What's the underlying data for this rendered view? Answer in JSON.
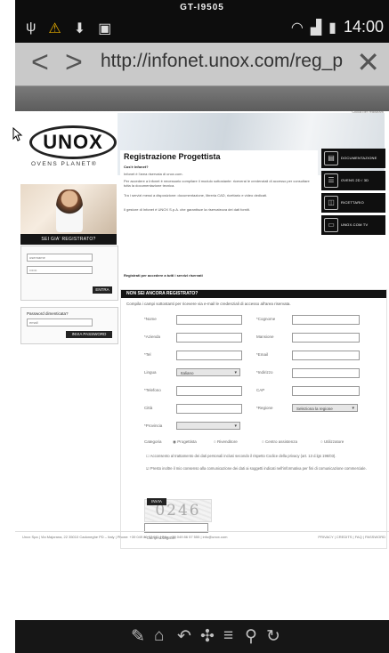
{
  "status": {
    "model": "GT-I9505",
    "time": "14:00",
    "icons_left": [
      "usb-icon",
      "alert-icon",
      "download-icon",
      "screenshot-icon"
    ],
    "icons_right": [
      "wifi-icon",
      "signal-icon",
      "battery-icon"
    ]
  },
  "browser": {
    "url": "http://infonet.unox.com/reg_p"
  },
  "site": {
    "logo_text": "UNOX",
    "logo_sub": "OVENS PLANET®",
    "register_bar": "SEI GIA' REGISTRATO?",
    "login": {
      "user_placeholder": "username",
      "pass_placeholder": "••••••",
      "button": "ENTRA"
    },
    "forgot": {
      "title": "Password dimenticata?",
      "placeholder": "email",
      "button": "INVIA PASSWORD"
    },
    "top_link": "Clicca per registrarti",
    "intro": {
      "title": "Registrazione Progettista",
      "subtitle": "Cos'è Infonet?",
      "p1": "Infonet è l'area riservata di unox.com.",
      "p2": "Per accedere a Infonet è necessario compilare il modulo sottostante: riceverai le credenziali di accesso per consultare tutta la documentazione tecnica.",
      "p3": "Tra i servizi messi a disposizione: documentazione, libreria CAD, ricettario e video dedicati.",
      "p4": "Il gestore di Infonet è UNOX S.p.A. che garantisce la riservatezza dei dati forniti.",
      "footer": "Registrati per accedere a tutti i servizi riservati"
    },
    "right_menu": [
      {
        "label": "DOCUMENTAZIONE",
        "icon": "document-icon"
      },
      {
        "label": "OVENS 2D / 3D",
        "icon": "database-icon"
      },
      {
        "label": "RICETTARIO",
        "icon": "recipe-icon"
      },
      {
        "label": "UNOX.COM TV",
        "icon": "tv-icon"
      }
    ],
    "form": {
      "header": "NON SEI ANCORA REGISTRATO?",
      "desc": "Compila i campi sottostanti per ricevere via e-mail le credenziali di accesso all'area riservata.",
      "fields": {
        "nome": "*Nome",
        "cognome": "*Cognome",
        "azienda": "*Azienda",
        "mansione": "Mansione",
        "tel": "*Tel",
        "email": "*Email",
        "lingua": "Lingua",
        "lingua_value": "Italiano",
        "indirizzo": "*Indirizzo",
        "telefono": "*Telefono",
        "cap": "CAP",
        "citta": "Città",
        "regione": "*Regione",
        "regione_value": "Seleziona la regione",
        "provincia": "*Provincia"
      },
      "category_label": "Categoria",
      "categories": [
        "Progettista",
        "Rivenditore",
        "Centro assistenza",
        "Utilizzatore"
      ],
      "privacy1": "Acconsento al trattamento dei dati personali inclusi secondo il rispetto Codice della privacy (art. 13 d.lgs 196/03).",
      "privacy2": "Presto inoltre il mio consenso alla comunicazione dei dati ai soggetti indicati nell'informativa per fini di comunicazione commerciale.",
      "captcha": "0246",
      "required_note": "* Campi obbligatori",
      "submit": "INVIA"
    },
    "footer_left": "Unox Spa | Via Majorana, 22 35010 Cadoneghe PD – Italy | Phone: +39 049 86 57 511 | Fax: +39 049 86 57 555 | info@unox.com",
    "footer_right": "PRIVACY | CREDITS | FAQ | PASSWORD"
  },
  "navbar": [
    "pen-icon",
    "home-icon",
    "back-icon",
    "move-icon",
    "menu-icon",
    "search-icon",
    "refresh-icon"
  ]
}
